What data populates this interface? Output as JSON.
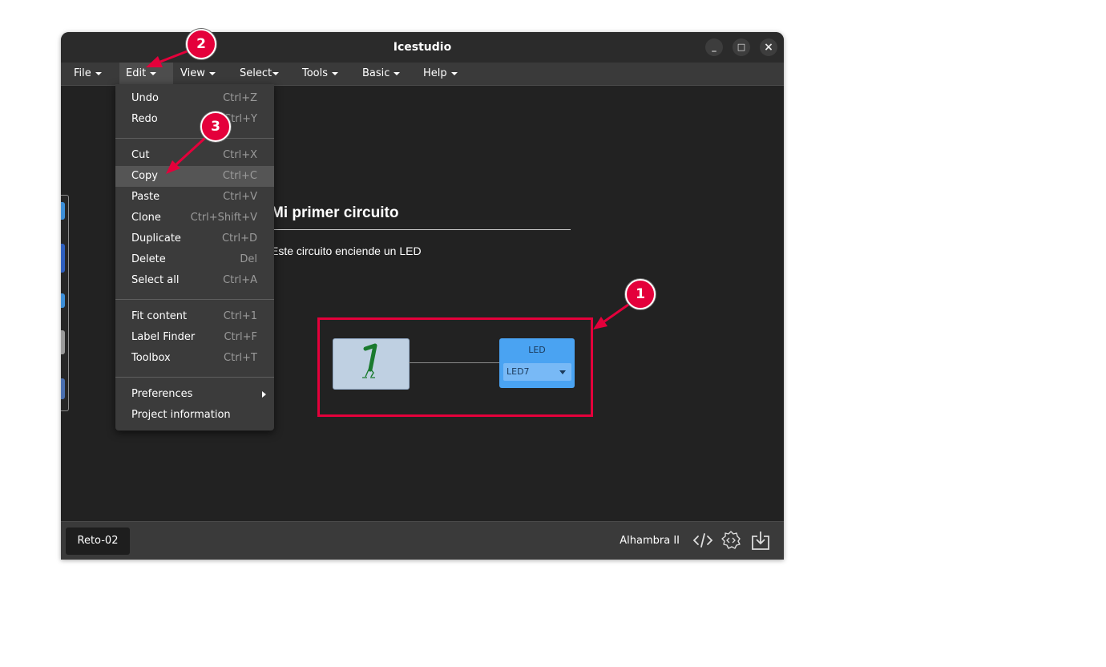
{
  "window": {
    "title": "Icestudio",
    "controls": {
      "minimize": "_",
      "maximize": "□",
      "close": "×"
    }
  },
  "menubar": {
    "file": "File",
    "edit": "Edit",
    "view": "View",
    "select": "Select",
    "tools": "Tools",
    "basic": "Basic",
    "help": "Help",
    "active": "Edit"
  },
  "edit_menu": {
    "items": [
      {
        "label": "Undo",
        "shortcut": "Ctrl+Z"
      },
      {
        "label": "Redo",
        "shortcut": "Ctrl+Y"
      },
      {
        "label": "Cut",
        "shortcut": "Ctrl+X"
      },
      {
        "label": "Copy",
        "shortcut": "Ctrl+C"
      },
      {
        "label": "Paste",
        "shortcut": "Ctrl+V"
      },
      {
        "label": "Clone",
        "shortcut": "Ctrl+Shift+V"
      },
      {
        "label": "Duplicate",
        "shortcut": "Ctrl+D"
      },
      {
        "label": "Delete",
        "shortcut": "Del"
      },
      {
        "label": "Select all",
        "shortcut": "Ctrl+A"
      },
      {
        "label": "Fit content",
        "shortcut": "Ctrl+1"
      },
      {
        "label": "Label Finder",
        "shortcut": "Ctrl+F"
      },
      {
        "label": "Toolbox",
        "shortcut": "Ctrl+T"
      },
      {
        "label": "Preferences",
        "shortcut": ""
      },
      {
        "label": "Project information",
        "shortcut": ""
      }
    ],
    "highlighted": "Copy"
  },
  "canvas": {
    "info_title": "Mi primer circuito",
    "info_text": "Este circuito enciende un LED",
    "constant_block": {
      "value": "1"
    },
    "led_block": {
      "title": "LED",
      "pin": "LED7"
    }
  },
  "statusbar": {
    "project_name": "Reto-02",
    "board": "Alhambra II",
    "icons": [
      "code-icon",
      "verilog-settings-icon",
      "upload-icon"
    ]
  },
  "annotations": {
    "callout_1": "1",
    "callout_2": "2",
    "callout_3": "3",
    "color": "#e4003b"
  }
}
